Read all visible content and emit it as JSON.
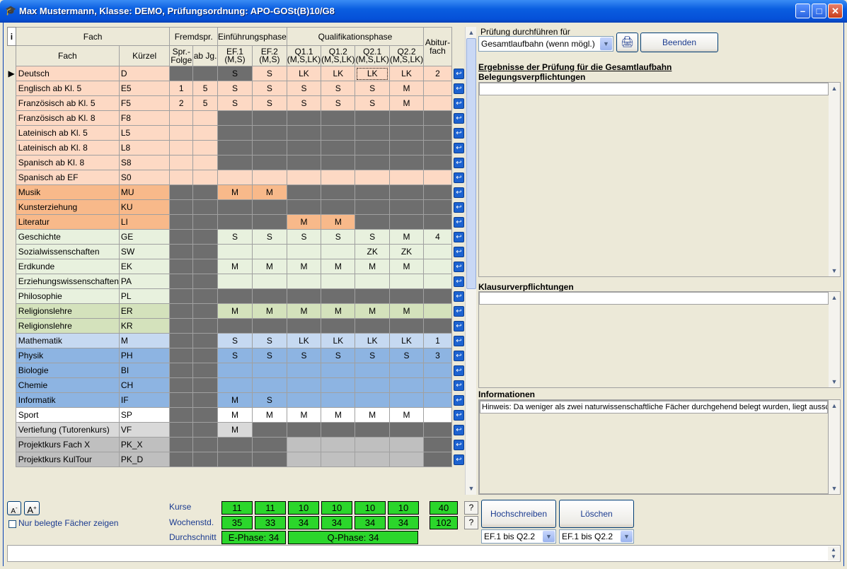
{
  "window": {
    "title": "Max Mustermann, Klasse: DEMO, Prüfungsordnung: APO-GOSt(B)10/G8",
    "icon": "mortarboard-icon",
    "min": "–",
    "max": "□",
    "close": "✕"
  },
  "grid": {
    "info_button": "i",
    "hdr_fach_group": "Fach",
    "hdr_fremd": "Fremdspr.",
    "hdr_ef": "Einführungsphase",
    "hdr_q": "Qualifikationsphase",
    "hdr_abi": "Abitur-fach",
    "hdr_fach": "Fach",
    "hdr_kuerzel": "Kürzel",
    "hdr_spr": "Spr.-Folge",
    "hdr_abjg": "ab Jg.",
    "hdr_ef1": "EF.1",
    "hdr_ef1s": "(M,S)",
    "hdr_ef2": "EF.2",
    "hdr_ef2s": "(M,S)",
    "hdr_q11": "Q1.1",
    "hdr_q11s": "(M,S,LK)",
    "hdr_q12": "Q1.2",
    "hdr_q12s": "(M,S,LK)",
    "hdr_q21": "Q2.1",
    "hdr_q21s": "(M,S,LK)",
    "hdr_q22": "Q2.2",
    "hdr_q22s": "(M,S,LK)",
    "rows": [
      {
        "name": "Deutsch",
        "kz": "D",
        "c": "#fdd9c4",
        "spr": "",
        "jg": "",
        "ef1": "S",
        "ef2": "S",
        "q11": "LK",
        "q12": "LK",
        "q21": "LK",
        "q22": "LK",
        "abi": "2",
        "k": "dddnnnnnnn",
        "sel": 1
      },
      {
        "name": "Englisch ab Kl. 5",
        "kz": "E5",
        "c": "#fdd9c4",
        "spr": "1",
        "jg": "5",
        "ef1": "S",
        "ef2": "S",
        "q11": "S",
        "q12": "S",
        "q21": "S",
        "q22": "M",
        "abi": "",
        "k": "nnnnnnnnnn"
      },
      {
        "name": "Französisch ab Kl. 5",
        "kz": "F5",
        "c": "#fdd9c4",
        "spr": "2",
        "jg": "5",
        "ef1": "S",
        "ef2": "S",
        "q11": "S",
        "q12": "S",
        "q21": "S",
        "q22": "M",
        "abi": "",
        "k": "nnnnnnnnnn"
      },
      {
        "name": "Französisch ab Kl. 8",
        "kz": "F8",
        "c": "#fdd9c4",
        "spr": "",
        "jg": "",
        "ef1": "",
        "ef2": "",
        "q11": "",
        "q12": "",
        "q21": "",
        "q22": "",
        "abi": "",
        "k": "nndddddddd"
      },
      {
        "name": "Lateinisch ab Kl. 5",
        "kz": "L5",
        "c": "#fdd9c4",
        "spr": "",
        "jg": "",
        "ef1": "",
        "ef2": "",
        "q11": "",
        "q12": "",
        "q21": "",
        "q22": "",
        "abi": "",
        "k": "nndddddddd"
      },
      {
        "name": "Lateinisch ab Kl. 8",
        "kz": "L8",
        "c": "#fdd9c4",
        "spr": "",
        "jg": "",
        "ef1": "",
        "ef2": "",
        "q11": "",
        "q12": "",
        "q21": "",
        "q22": "",
        "abi": "",
        "k": "nndddddddd"
      },
      {
        "name": "Spanisch ab Kl. 8",
        "kz": "S8",
        "c": "#fdd9c4",
        "spr": "",
        "jg": "",
        "ef1": "",
        "ef2": "",
        "q11": "",
        "q12": "",
        "q21": "",
        "q22": "",
        "abi": "",
        "k": "nndddddddd"
      },
      {
        "name": "Spanisch ab EF",
        "kz": "S0",
        "c": "#fdd9c4",
        "spr": "",
        "jg": "",
        "ef1": "",
        "ef2": "",
        "q11": "",
        "q12": "",
        "q21": "",
        "q22": "",
        "abi": "",
        "k": "nnnnnnnnnd"
      },
      {
        "name": "Musik",
        "kz": "MU",
        "c": "#f8b98a",
        "spr": "",
        "jg": "",
        "ef1": "M",
        "ef2": "M",
        "q11": "",
        "q12": "",
        "q21": "",
        "q22": "",
        "abi": "",
        "k": "ddnndddddd"
      },
      {
        "name": "Kunsterziehung",
        "kz": "KU",
        "c": "#f8b98a",
        "spr": "",
        "jg": "",
        "ef1": "",
        "ef2": "",
        "q11": "",
        "q12": "",
        "q21": "",
        "q22": "",
        "abi": "",
        "k": "dddddddddd"
      },
      {
        "name": "Literatur",
        "kz": "LI",
        "c": "#f8b98a",
        "spr": "",
        "jg": "",
        "ef1": "",
        "ef2": "",
        "q11": "M",
        "q12": "M",
        "q21": "",
        "q22": "",
        "abi": "",
        "k": "ddddnndddd"
      },
      {
        "name": "Geschichte",
        "kz": "GE",
        "c": "#e8f1de",
        "spr": "",
        "jg": "",
        "ef1": "S",
        "ef2": "S",
        "q11": "S",
        "q12": "S",
        "q21": "S",
        "q22": "M",
        "abi": "4",
        "k": "ddnnnnnnnn"
      },
      {
        "name": "Sozialwissenschaften",
        "kz": "SW",
        "c": "#e8f1de",
        "spr": "",
        "jg": "",
        "ef1": "",
        "ef2": "",
        "q11": "",
        "q12": "",
        "q21": "ZK",
        "q22": "ZK",
        "abi": "",
        "k": "ddnnnnnnnd"
      },
      {
        "name": "Erdkunde",
        "kz": "EK",
        "c": "#e8f1de",
        "spr": "",
        "jg": "",
        "ef1": "M",
        "ef2": "M",
        "q11": "M",
        "q12": "M",
        "q21": "M",
        "q22": "M",
        "abi": "",
        "k": "ddnnnnnnnn"
      },
      {
        "name": "Erziehungswissenschaften",
        "kz": "PA",
        "c": "#e8f1de",
        "spr": "",
        "jg": "",
        "ef1": "",
        "ef2": "",
        "q11": "",
        "q12": "",
        "q21": "",
        "q22": "",
        "abi": "",
        "k": "ddnnnnnnnn"
      },
      {
        "name": "Philosophie",
        "kz": "PL",
        "c": "#e8f1de",
        "spr": "",
        "jg": "",
        "ef1": "",
        "ef2": "",
        "q11": "",
        "q12": "",
        "q21": "",
        "q22": "",
        "abi": "",
        "k": "dddddddddd"
      },
      {
        "name": "Religionslehre",
        "kz": "ER",
        "c": "#d4e2bc",
        "spr": "",
        "jg": "",
        "ef1": "M",
        "ef2": "M",
        "q11": "M",
        "q12": "M",
        "q21": "M",
        "q22": "M",
        "abi": "",
        "k": "ddnnnnnnnn"
      },
      {
        "name": "Religionslehre",
        "kz": "KR",
        "c": "#d4e2bc",
        "spr": "",
        "jg": "",
        "ef1": "",
        "ef2": "",
        "q11": "",
        "q12": "",
        "q21": "",
        "q22": "",
        "abi": "",
        "k": "dddddddddd"
      },
      {
        "name": "Mathematik",
        "kz": "M",
        "c": "#c6d9f1",
        "spr": "",
        "jg": "",
        "ef1": "S",
        "ef2": "S",
        "q11": "LK",
        "q12": "LK",
        "q21": "LK",
        "q22": "LK",
        "abi": "1",
        "k": "ddnnnnnnnn"
      },
      {
        "name": "Physik",
        "kz": "PH",
        "c": "#8db4e2",
        "spr": "",
        "jg": "",
        "ef1": "S",
        "ef2": "S",
        "q11": "S",
        "q12": "S",
        "q21": "S",
        "q22": "S",
        "abi": "3",
        "k": "ddnnnnnnnn"
      },
      {
        "name": "Biologie",
        "kz": "BI",
        "c": "#8db4e2",
        "spr": "",
        "jg": "",
        "ef1": "",
        "ef2": "",
        "q11": "",
        "q12": "",
        "q21": "",
        "q22": "",
        "abi": "",
        "k": "ddnnnnnnnn"
      },
      {
        "name": "Chemie",
        "kz": "CH",
        "c": "#8db4e2",
        "spr": "",
        "jg": "",
        "ef1": "",
        "ef2": "",
        "q11": "",
        "q12": "",
        "q21": "",
        "q22": "",
        "abi": "",
        "k": "ddnnnnnnnn"
      },
      {
        "name": "Informatik",
        "kz": "IF",
        "c": "#8db4e2",
        "spr": "",
        "jg": "",
        "ef1": "M",
        "ef2": "S",
        "q11": "",
        "q12": "",
        "q21": "",
        "q22": "",
        "abi": "",
        "k": "ddnnnnnnnd"
      },
      {
        "name": "Sport",
        "kz": "SP",
        "c": "#ffffff",
        "spr": "",
        "jg": "",
        "ef1": "M",
        "ef2": "M",
        "q11": "M",
        "q12": "M",
        "q21": "M",
        "q22": "M",
        "abi": "",
        "k": "ddnnnnnnnd"
      },
      {
        "name": "Vertiefung (Tutorenkurs)",
        "kz": "VF",
        "c": "#d9d9d9",
        "spr": "",
        "jg": "",
        "ef1": "M",
        "ef2": "",
        "q11": "",
        "q12": "",
        "q21": "",
        "q22": "",
        "abi": "",
        "k": "ddnddddddd"
      },
      {
        "name": "Projektkurs Fach X",
        "kz": "PK_X",
        "c": "#bfbfbf",
        "spr": "",
        "jg": "",
        "ef1": "",
        "ef2": "",
        "q11": "",
        "q12": "",
        "q21": "",
        "q22": "",
        "abi": "",
        "k": "ddddllnndd"
      },
      {
        "name": "Projektkurs KulTour",
        "kz": "PK_D",
        "c": "#bfbfbf",
        "spr": "",
        "jg": "",
        "ef1": "",
        "ef2": "",
        "q11": "",
        "q12": "",
        "q21": "",
        "q22": "",
        "abi": "",
        "k": "ddddllnndd"
      }
    ]
  },
  "right": {
    "pruefung_label": "Prüfung durchführen für",
    "pruefung_value": "Gesamtlaufbahn (wenn mögl.)",
    "print_icon": "printer-icon",
    "beenden": "Beenden",
    "ergebnis_title": "Ergebnisse der Prüfung für die Gesamtlaufbahn",
    "belegung_title": "Belegungsverpflichtungen",
    "klausur_title": "Klausurverpflichtungen",
    "info_title": "Informationen",
    "info_text": "Hinweis: Da weniger als zwei naturwissenschaftliche Fächer durchgehend belegt wurden, liegt ausschl"
  },
  "bottom": {
    "font_down": "A",
    "font_up": "A",
    "checkbox_label": "Nur belegte Fächer zeigen",
    "kurse_label": "Kurse",
    "wochen_label": "Wochenstd.",
    "durch_label": "Durchschnitt",
    "kurse": [
      "11",
      "11",
      "10",
      "10",
      "10",
      "10"
    ],
    "kurse_total": "40",
    "wochen": [
      "35",
      "33",
      "34",
      "34",
      "34",
      "34"
    ],
    "wochen_total": "102",
    "e_phase": "E-Phase: 34",
    "q_phase": "Q-Phase: 34",
    "help": "?",
    "hochschreiben": "Hochschreiben",
    "loeschen": "Löschen",
    "range1": "EF.1 bis Q2.2",
    "range2": "EF.1 bis Q2.2"
  }
}
